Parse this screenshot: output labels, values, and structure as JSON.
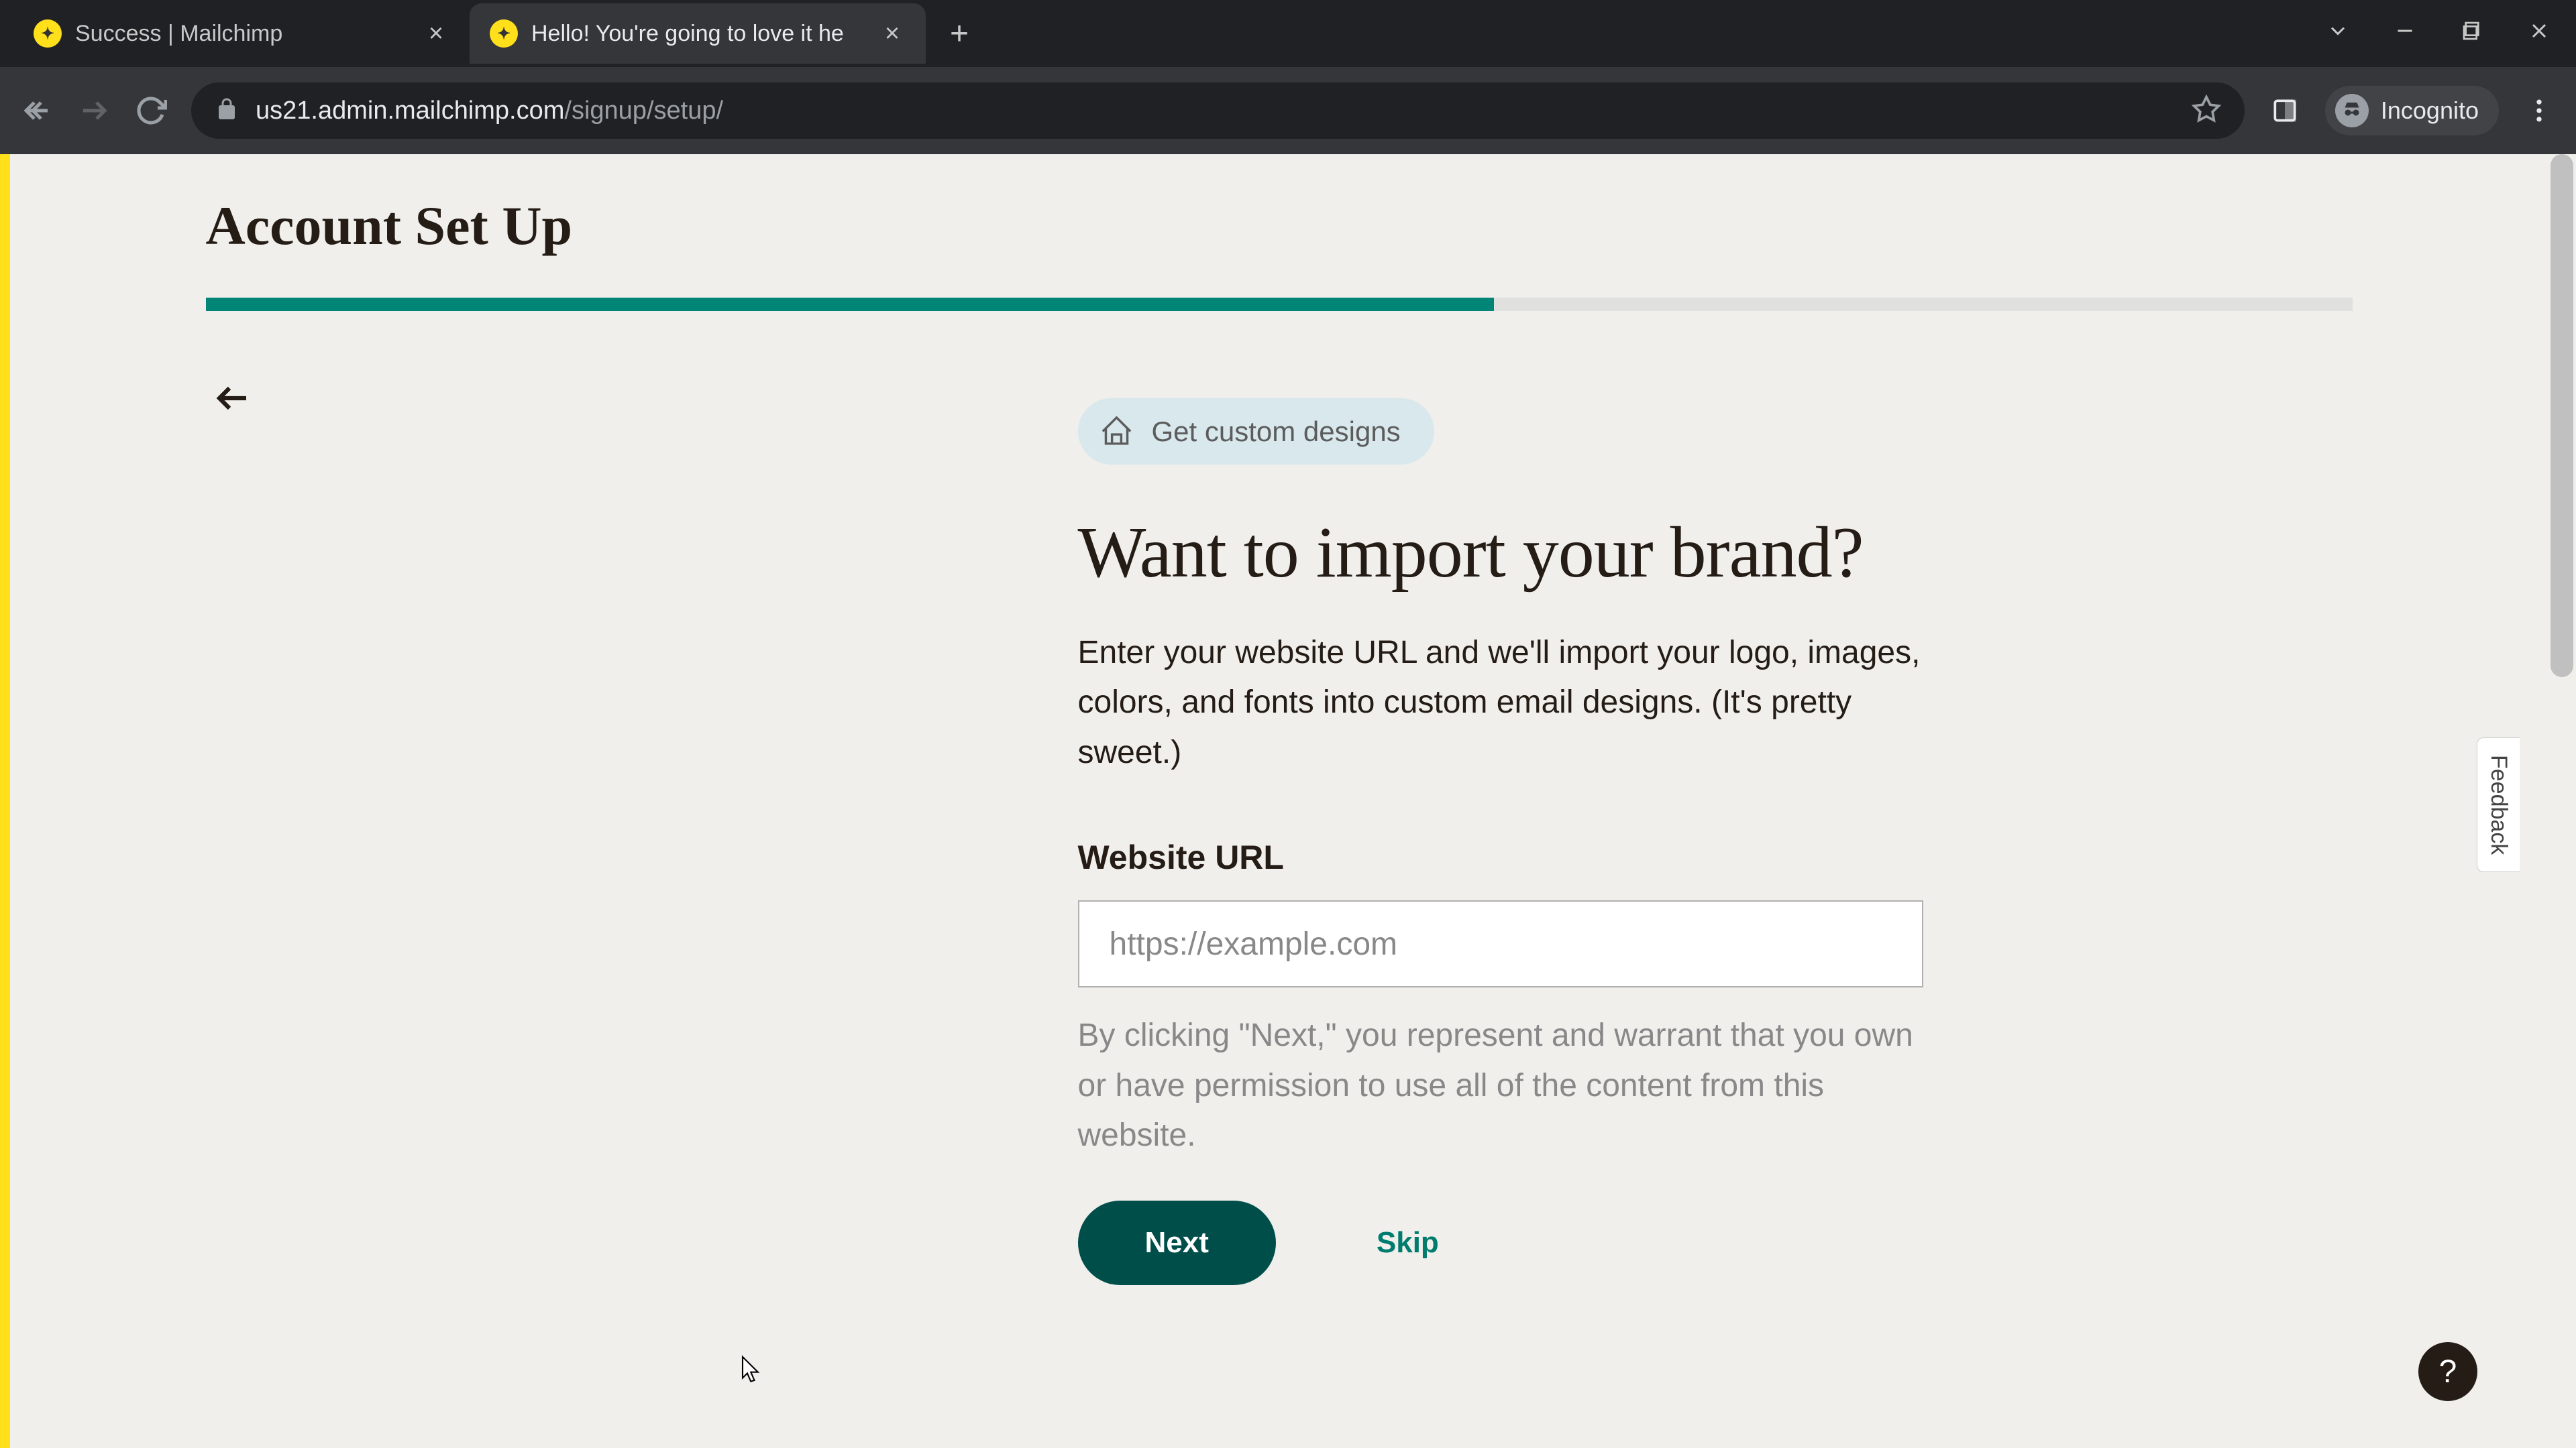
{
  "browser": {
    "tabs": [
      {
        "title": "Success | Mailchimp",
        "active": false
      },
      {
        "title": "Hello! You're going to love it he",
        "active": true
      }
    ],
    "url_host": "us21.admin.mailchimp.com",
    "url_path": "/signup/setup/",
    "incognito_label": "Incognito"
  },
  "page": {
    "heading": "Account Set Up",
    "progress_percent": 60,
    "pill_label": "Get custom designs",
    "title": "Want to import your brand?",
    "description": "Enter your website URL and we'll import your logo, images, colors, and fonts into custom email designs. (It's pretty sweet.)",
    "field_label": "Website URL",
    "input_placeholder": "https://example.com",
    "disclaimer": "By clicking \"Next,\" you represent and warrant that you own or have permission to use all of the content from this website.",
    "next_button": "Next",
    "skip_button": "Skip",
    "feedback_label": "Feedback",
    "help_label": "?"
  }
}
